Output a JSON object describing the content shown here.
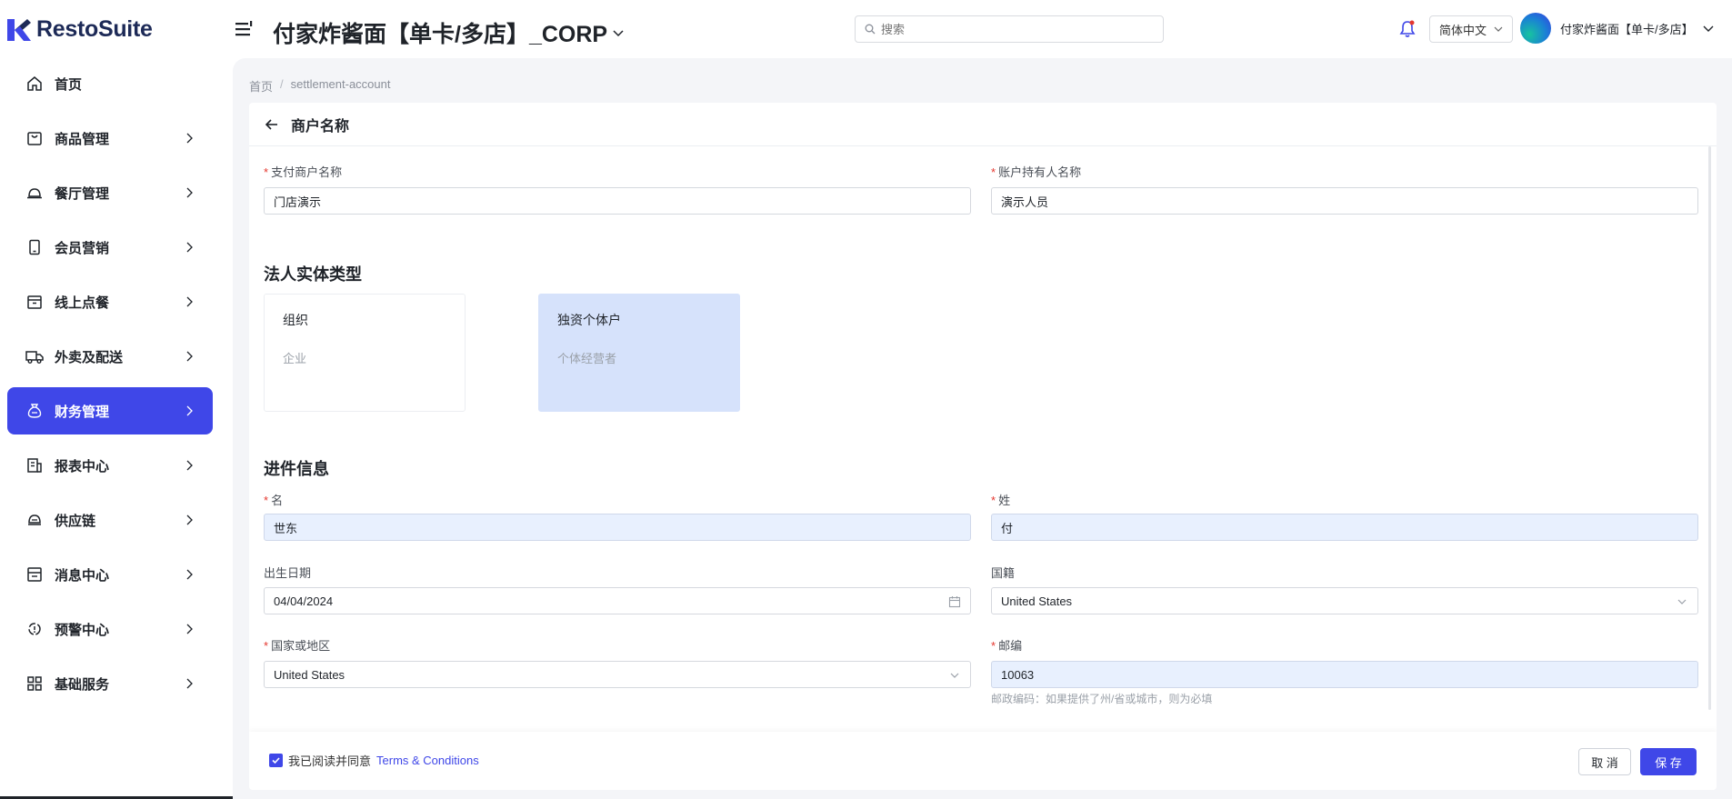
{
  "app": {
    "brand": "RestoSuite"
  },
  "header": {
    "store_title": "付家炸酱面【单卡/多店】_CORP",
    "search_placeholder": "搜索",
    "language": "简体中文",
    "user_name": "付家炸酱面【单卡/多店】",
    "accent_color": "#3f47e8"
  },
  "sidebar": {
    "items": [
      {
        "label": "首页",
        "icon": "home-icon"
      },
      {
        "label": "商品管理",
        "icon": "bag-icon"
      },
      {
        "label": "餐厅管理",
        "icon": "cloche-icon"
      },
      {
        "label": "会员营销",
        "icon": "phone-icon"
      },
      {
        "label": "线上点餐",
        "icon": "store-icon"
      },
      {
        "label": "外卖及配送",
        "icon": "truck-icon"
      },
      {
        "label": "财务管理",
        "icon": "money-bag-icon",
        "active": true
      },
      {
        "label": "报表中心",
        "icon": "report-icon"
      },
      {
        "label": "供应链",
        "icon": "supply-icon"
      },
      {
        "label": "消息中心",
        "icon": "message-icon"
      },
      {
        "label": "预警中心",
        "icon": "alert-icon"
      },
      {
        "label": "基础服务",
        "icon": "grid-icon"
      }
    ]
  },
  "breadcrumb": {
    "home": "首页",
    "current": "settlement-account"
  },
  "panel": {
    "title": "商户名称",
    "merchant": {
      "pay_merchant_label": "支付商户名称",
      "pay_merchant_value": "门店演示",
      "holder_label": "账户持有人名称",
      "holder_value": "演示人员"
    },
    "entity_section": "法人实体类型",
    "entity_cards": [
      {
        "title": "组织",
        "sub": "企业",
        "selected": false
      },
      {
        "title": "独资个体户",
        "sub": "个体经营者",
        "selected": true
      }
    ],
    "info_section": "进件信息",
    "fields": {
      "first_name_label": "名",
      "first_name_value": "世东",
      "last_name_label": "姓",
      "last_name_value": "付",
      "dob_label": "出生日期",
      "dob_value": "04/04/2024",
      "nationality_label": "国籍",
      "nationality_value": "United States",
      "country_label": "国家或地区",
      "country_value": "United States",
      "zip_label": "邮编",
      "zip_value": "10063",
      "zip_hint": "邮政编码：如果提供了州/省或城市，则为必填"
    },
    "footer": {
      "agree_text": "我已阅读并同意",
      "terms_link": "Terms & Conditions",
      "cancel": "取 消",
      "save": "保 存"
    }
  }
}
